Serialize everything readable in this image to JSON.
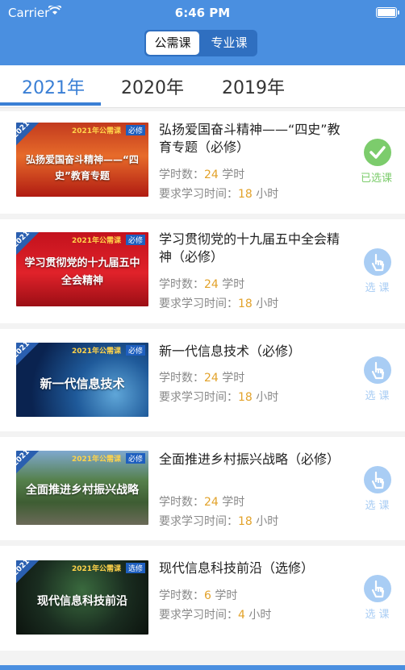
{
  "status": {
    "carrier": "Carrier",
    "time": "6:46 PM"
  },
  "segment": {
    "options": [
      "公需课",
      "专业课"
    ]
  },
  "tabs": [
    "2021年",
    "2020年",
    "2019年"
  ],
  "labels": {
    "hours_label": "学时数：",
    "hours_unit": " 学时",
    "time_label": "要求学习时间：",
    "time_unit": " 小时"
  },
  "thumb": {
    "year": "2021",
    "tag_name": "2021年公需课",
    "tag_required": "必修",
    "tag_optional": "选修"
  },
  "courses": [
    {
      "title": "弘扬爱国奋斗精神——“四史”教育专题（必修）",
      "hours": "24",
      "time": "18",
      "status": "已选课",
      "caption": "弘扬爱国奋斗精神——“四史”教育专题"
    },
    {
      "title": "学习贯彻党的十九届五中全会精神（必修）",
      "hours": "24",
      "time": "18",
      "status": "选课",
      "caption": "学习贯彻党的十九届五中全会精神"
    },
    {
      "title": "新一代信息技术（必修）",
      "hours": "24",
      "time": "18",
      "status": "选课",
      "caption": "新一代信息技术"
    },
    {
      "title": "全面推进乡村振兴战略（必修）",
      "hours": "24",
      "time": "18",
      "status": "选课",
      "caption": "全面推进乡村振兴战略"
    },
    {
      "title": "现代信息科技前沿（选修）",
      "hours": "6",
      "time": "4",
      "status": "选课",
      "caption": "现代信息科技前沿"
    }
  ],
  "colors": {
    "primary": "#4a8fe0",
    "accent": "#3a7fd5",
    "number": "#e2a22a",
    "done": "#7ccc6c",
    "select": "#a9cdf4"
  }
}
